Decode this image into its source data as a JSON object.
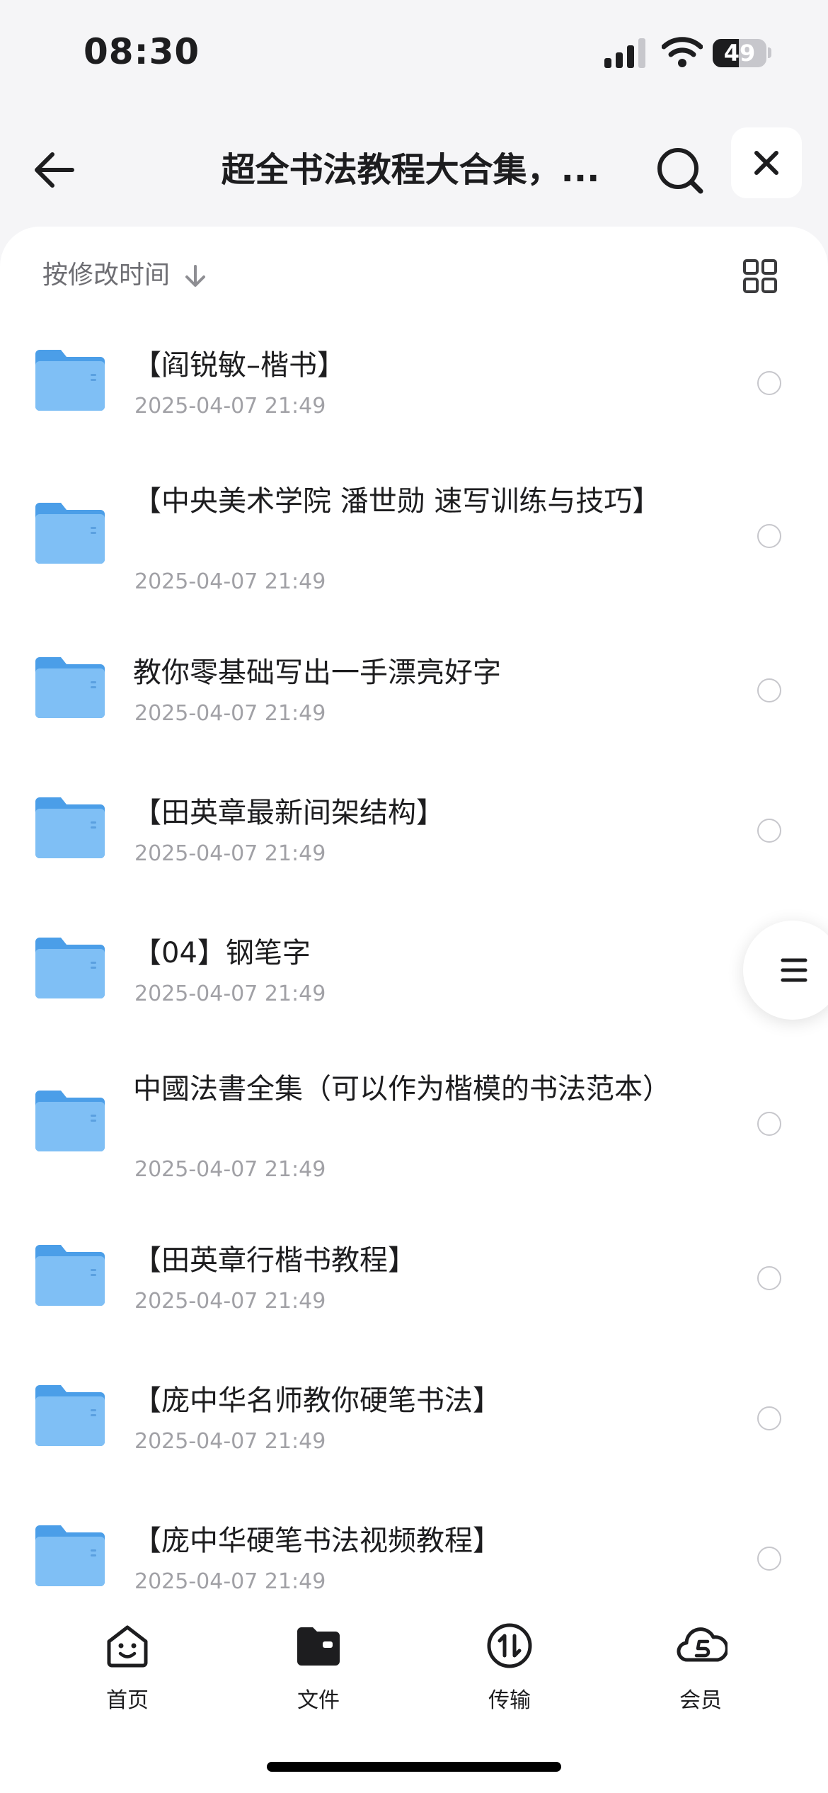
{
  "status_bar": {
    "time": "08:30",
    "battery": "49",
    "battery_level": 0.49
  },
  "header": {
    "title": "超全书法教程大合集，..."
  },
  "sort": {
    "label": "按修改时间"
  },
  "files": [
    {
      "name": "【阎锐敏–楷书】",
      "date": "2025-04-07 21:49"
    },
    {
      "name": "【中央美术学院 潘世勋 速写训练与技巧】",
      "date": "2025-04-07 21:49"
    },
    {
      "name": "教你零基础写出一手漂亮好字",
      "date": "2025-04-07 21:49"
    },
    {
      "name": "【田英章最新间架结构】",
      "date": "2025-04-07 21:49"
    },
    {
      "name": "【04】钢笔字",
      "date": "2025-04-07 21:49"
    },
    {
      "name": "中國法書全集（可以作为楷模的书法范本）",
      "date": "2025-04-07 21:49"
    },
    {
      "name": "【田英章行楷书教程】",
      "date": "2025-04-07 21:49"
    },
    {
      "name": "【庞中华名师教你硬笔书法】",
      "date": "2025-04-07 21:49"
    },
    {
      "name": "【庞中华硬笔书法视频教程】",
      "date": "2025-04-07 21:49"
    }
  ],
  "tabs": [
    {
      "label": "首页",
      "icon": "home-smile-icon"
    },
    {
      "label": "文件",
      "icon": "folder-icon",
      "active": true
    },
    {
      "label": "传输",
      "icon": "transfer-icon"
    },
    {
      "label": "会员",
      "icon": "vip-cloud-icon"
    }
  ],
  "colors": {
    "accent_folder": "#5aa9f0",
    "text": "#1d1d1f",
    "secondary": "#a1a1a6"
  }
}
